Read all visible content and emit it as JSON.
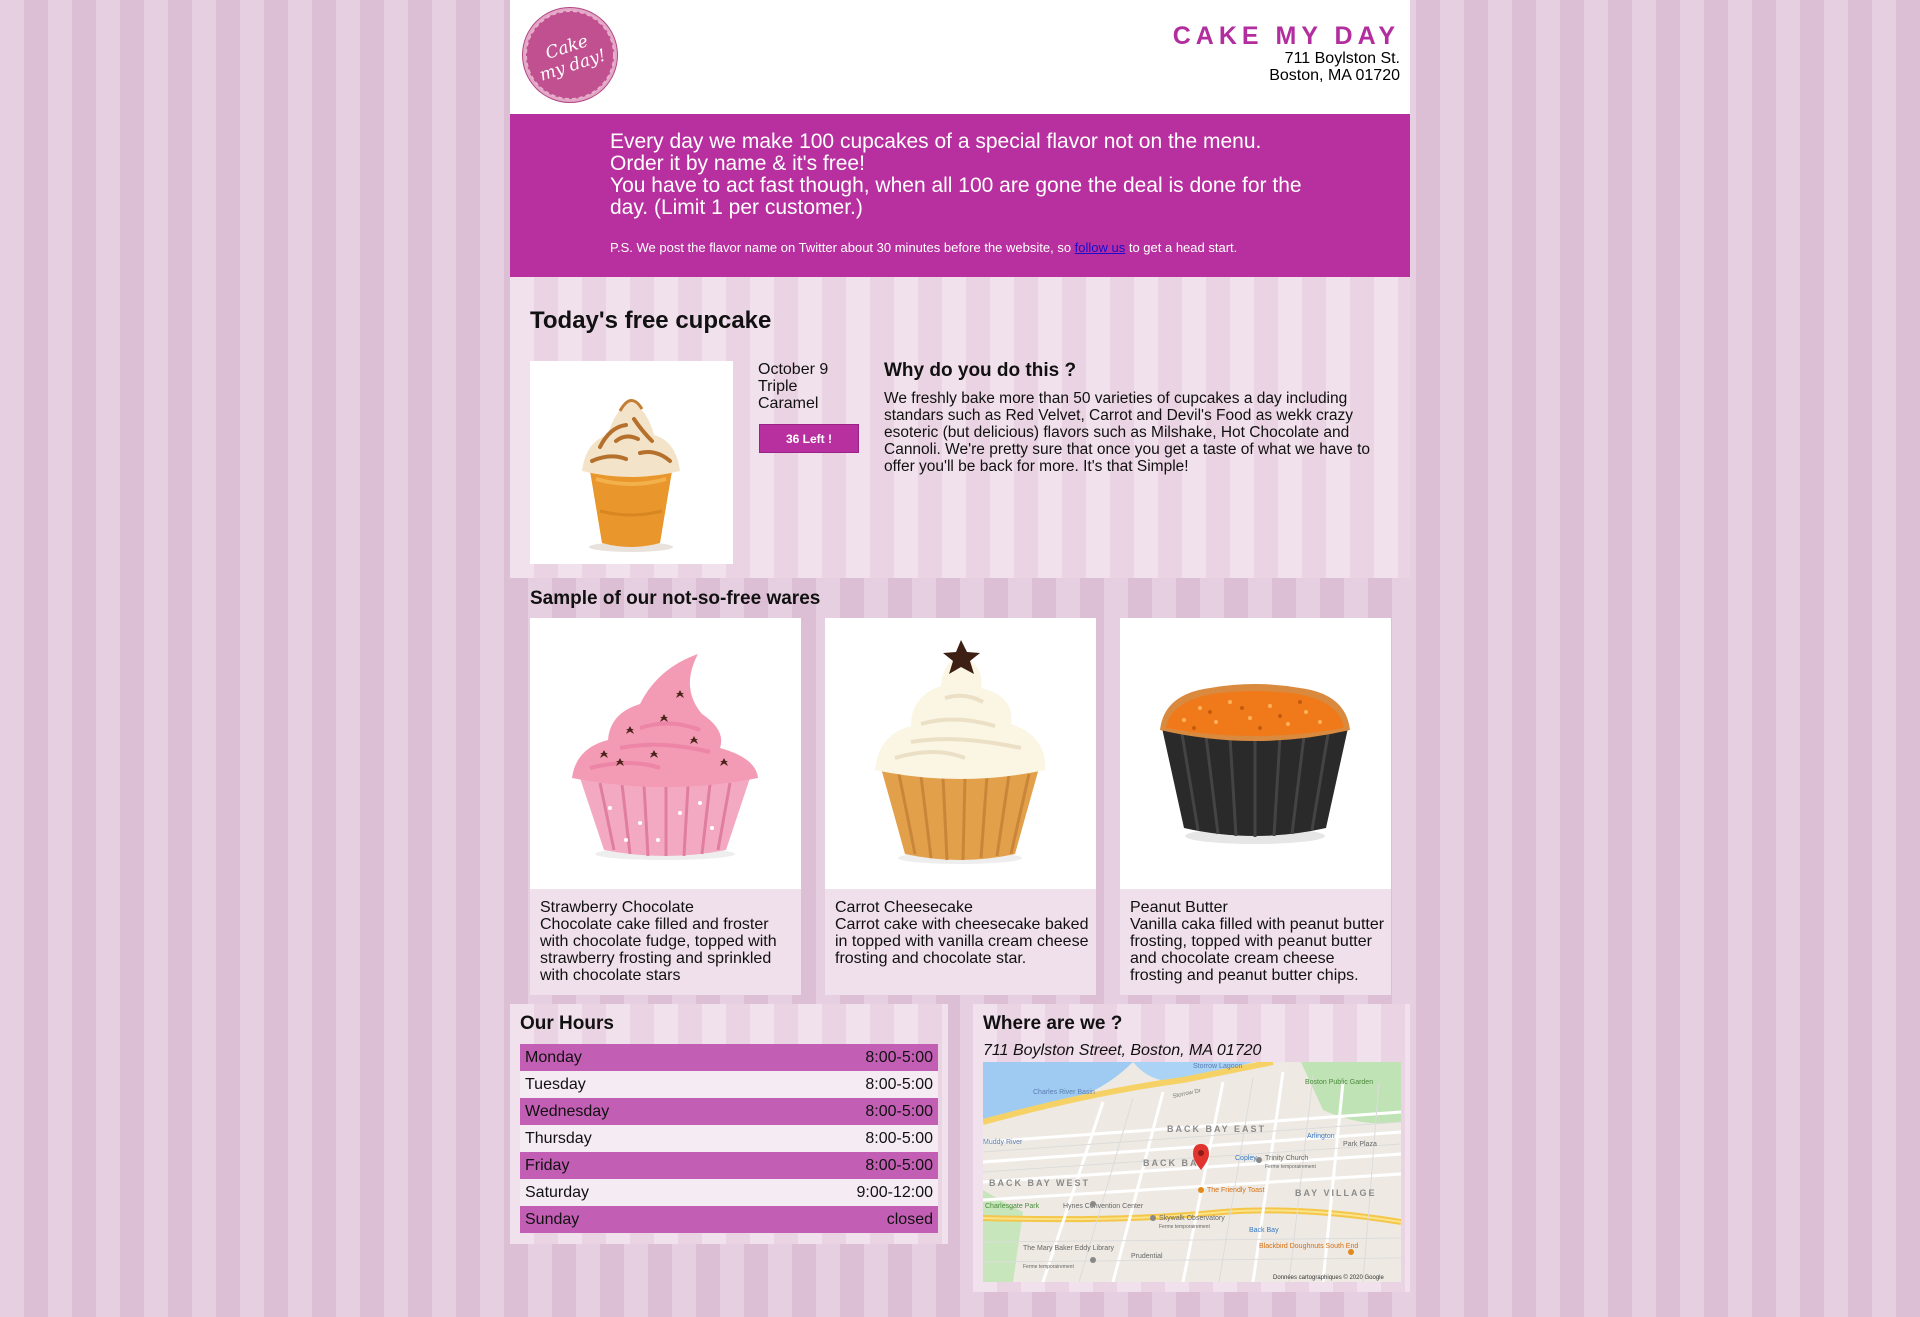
{
  "header": {
    "logo_text_line1": "Cake",
    "logo_text_line2": "my day!",
    "brand_name": "CAKE MY DAY",
    "address_line1": "711 Boylston St.",
    "address_line2": "Boston, MA 01720"
  },
  "banner": {
    "line1": "Every day we make 100 cupcakes of a special flavor not on the menu.",
    "line2": "Order it by name & it's free!",
    "line3": "You have to act fast though, when all 100 are gone the deal is done for the day. (Limit 1 per customer.)",
    "ps_before": "P.S. We post the flavor name on Twitter about 30 minutes before the website, so ",
    "ps_link": "follow us",
    "ps_after": " to get a head start."
  },
  "featured": {
    "title": "Today's free cupcake",
    "date": "October 9",
    "flavor_line1": "Triple",
    "flavor_line2": "Caramel",
    "left_badge": "36 Left !",
    "why_title": "Why do you do this ?",
    "why_text": "We freshly bake more than 50 varieties of cupcakes a day including standars such as Red Velvet, Carrot and Devil's Food as wekk crazy esoteric (but delicious) flavors such as Milshake, Hot Chocolate and Cannoli. We're pretty sure that once you get a taste of what we have to offer you'll be back for more. It's that Simple!"
  },
  "wares": {
    "title": "Sample of our not-so-free wares",
    "items": [
      {
        "name": "Strawberry Chocolate",
        "description": "Chocolate cake filled and froster with chocolate fudge, topped with strawberry frosting and sprinkled with chocolate stars"
      },
      {
        "name": "Carrot Cheesecake",
        "description": "Carrot cake with cheesecake baked in topped with vanilla cream cheese frosting and chocolate star."
      },
      {
        "name": "Peanut Butter",
        "description": "Vanilla caka filled with peanut butter frosting, topped with peanut butter and chocolate cream cheese frosting and peanut butter chips."
      }
    ]
  },
  "hours": {
    "title": "Our Hours",
    "rows": [
      {
        "day": "Monday",
        "time": "8:00-5:00"
      },
      {
        "day": "Tuesday",
        "time": "8:00-5:00"
      },
      {
        "day": "Wednesday",
        "time": "8:00-5:00"
      },
      {
        "day": "Thursday",
        "time": "8:00-5:00"
      },
      {
        "day": "Friday",
        "time": "8:00-5:00"
      },
      {
        "day": "Saturday",
        "time": "9:00-12:00"
      },
      {
        "day": "Sunday",
        "time": "closed"
      }
    ]
  },
  "location": {
    "title": "Where are we ?",
    "address": "711 Boylston Street, Boston, MA 01720",
    "map_labels": {
      "storrow_lagoon": "Storrow Lagoon",
      "boston_public_garden": "Boston Public Garden",
      "charles_river_basin": "Charles River Basin",
      "storrow_dr": "Storrow Dr",
      "back_bay_east": "BACK BAY EAST",
      "arlington": "Arlington",
      "park_plaza": "Park Plaza",
      "back_bay": "BACK BAY",
      "copley": "Copley",
      "trinity_church": "Trinity Church",
      "trinity_note": "Ferme temporairement",
      "back_bay_west": "BACK BAY WEST",
      "charlesgate_park": "Charlesgate Park",
      "friendly_toast": "The Friendly Toast",
      "bay_village": "BAY VILLAGE",
      "hynes": "Hynes Convention Center",
      "skywalk": "Skywalk Observatory",
      "skywalk_note": "Ferme temporairement",
      "back_bay_station": "Back Bay",
      "mary_baker": "The Mary Baker Eddy Library",
      "mary_baker_note": "Ferme temporairement",
      "prudential": "Prudential",
      "blackbird": "Blackbird Doughnuts South End",
      "muddy_river": "Muddy River",
      "copyright": "Données cartographiques © 2020 Google"
    }
  },
  "colors": {
    "brand": "#b22e9f",
    "banner": "#b8309f",
    "hours_alt_row": "#c35eb5"
  }
}
